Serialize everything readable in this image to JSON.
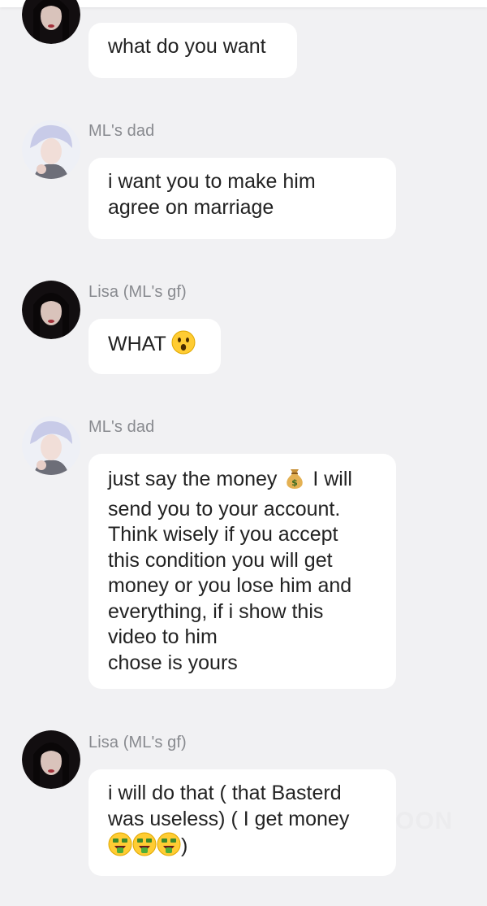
{
  "messages": [
    {
      "sender": "",
      "avatar": "lisa-avatar",
      "lines": [
        "what do you want"
      ]
    },
    {
      "sender": "ML's dad",
      "avatar": "dad-avatar",
      "lines": [
        "i want you to make him",
        "agree on marriage"
      ]
    },
    {
      "sender": "Lisa (ML's gf)",
      "avatar": "lisa-avatar",
      "lines": [
        "WHAT"
      ]
    },
    {
      "sender": "ML's dad",
      "avatar": "dad-avatar",
      "lines": [
        "just say the money",
        "I will",
        "send you to your account.",
        "Think wisely if you accept",
        "this condition you will get",
        "money or you lose him and",
        "everything, if i show this",
        "video to him",
        "chose is yours"
      ]
    },
    {
      "sender": "Lisa (ML's gf)",
      "avatar": "lisa-avatar",
      "lines": [
        "i will do that ( that Basterd",
        "was useless) ( I get money",
        ")"
      ]
    }
  ],
  "watermark": "OON",
  "emoji_names": [
    "astonished-face-emoji",
    "money-bag-emoji",
    "money-mouth-face-emoji"
  ],
  "colors": {
    "background": "#f1f1f3",
    "bubble": "#ffffff",
    "text": "#222222",
    "sender": "#888a8f"
  }
}
